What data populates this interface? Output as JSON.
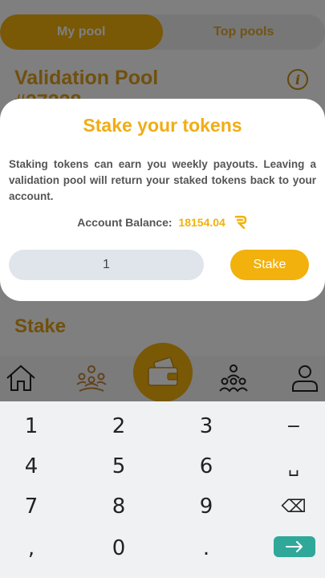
{
  "tabs": {
    "my_pool": "My pool",
    "top_pools": "Top pools"
  },
  "background": {
    "pool_title": "Validation Pool",
    "pool_title_line2": "#27228",
    "info_icon": "i",
    "stake_heading": "Stake"
  },
  "modal": {
    "title": "Stake your tokens",
    "description": "Staking tokens can earn you weekly payouts. Leaving a validation pool will return your staked tokens back to your account.",
    "balance_label": "Account Balance:",
    "balance_value": "18154.04",
    "input_value": "1",
    "stake_button": "Stake"
  },
  "nav": {
    "icons": [
      "home-icon",
      "community-icon",
      "wallet-icon",
      "network-icon",
      "profile-icon"
    ]
  },
  "keyboard": {
    "keys": [
      "1",
      "2",
      "3",
      "−",
      "4",
      "5",
      "6",
      "␣",
      "7",
      "8",
      "9",
      "⌫",
      ",",
      "0",
      "."
    ]
  },
  "colors": {
    "accent": "#f2b10c",
    "title": "#e0a01a",
    "enter": "#2fa89a"
  }
}
